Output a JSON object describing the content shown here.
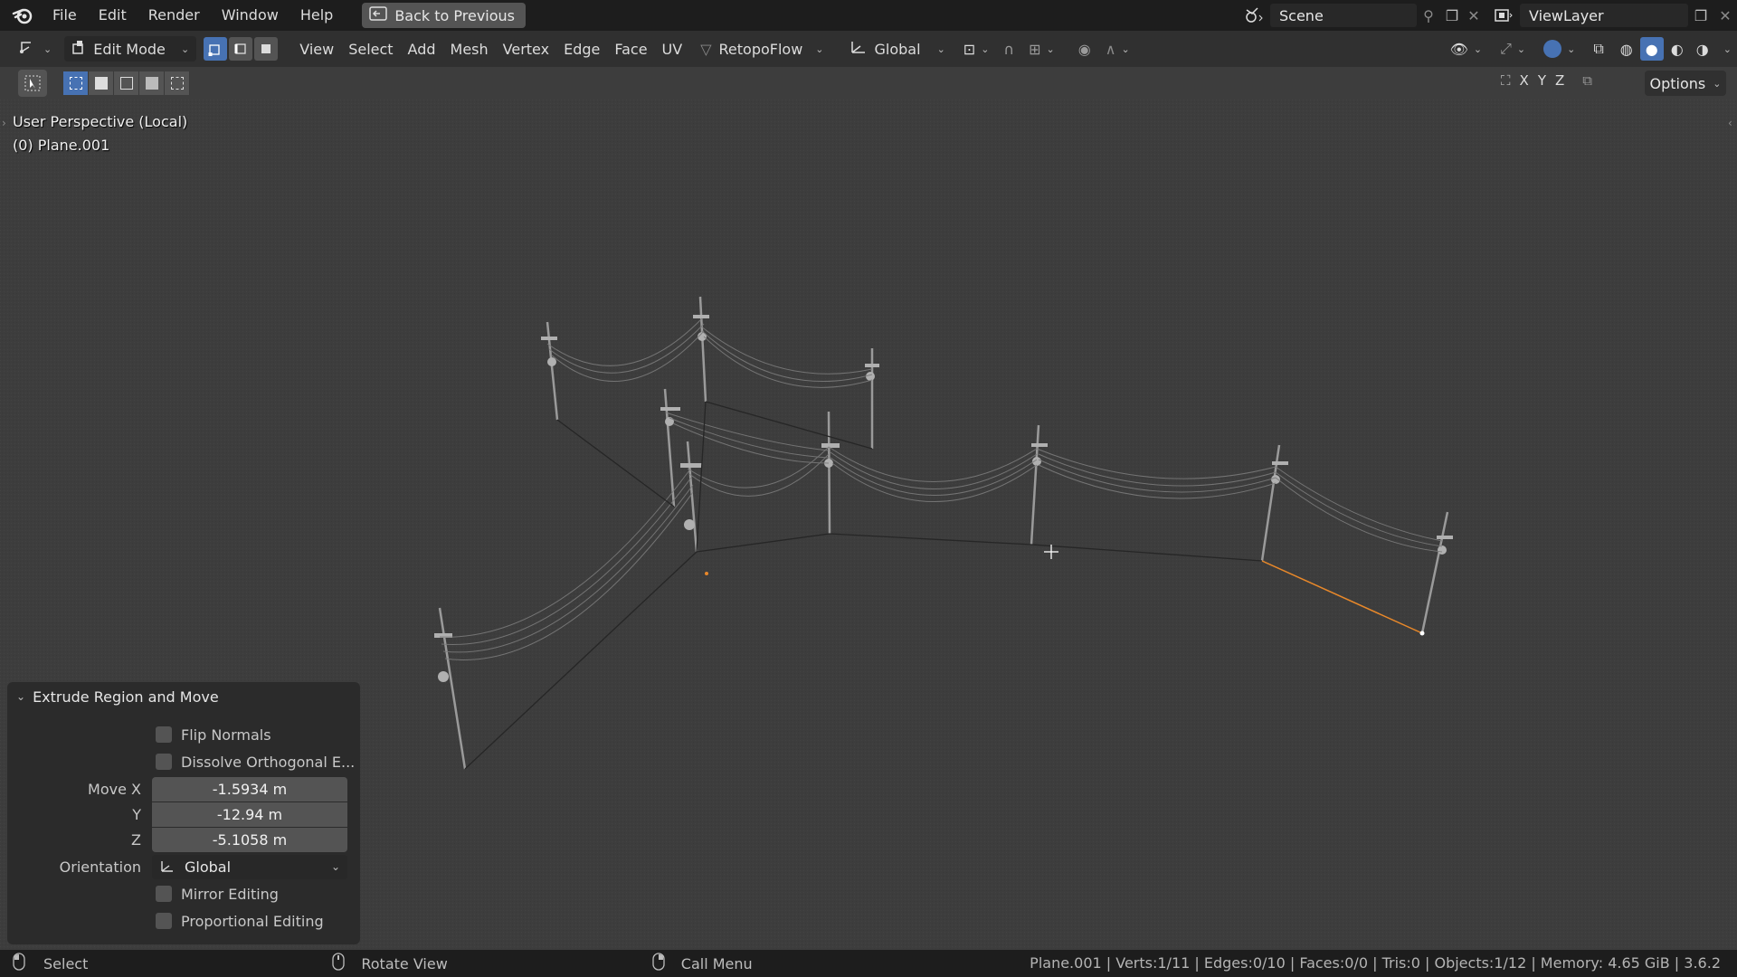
{
  "menus": [
    "File",
    "Edit",
    "Render",
    "Window",
    "Help"
  ],
  "back_button": "Back to Previous",
  "scene": "Scene",
  "view_layer": "ViewLayer",
  "header": {
    "mode": "Edit Mode",
    "menus": [
      "View",
      "Select",
      "Add",
      "Mesh",
      "Vertex",
      "Edge",
      "Face",
      "UV"
    ],
    "addon": "RetopoFlow",
    "orientation": "Global"
  },
  "toolrow": {
    "axes": [
      "X",
      "Y",
      "Z"
    ],
    "options": "Options"
  },
  "viewport": {
    "view_name": "User Perspective (Local)",
    "object": "(0) Plane.001"
  },
  "operator": {
    "title": "Extrude Region and Move",
    "flip_normals": "Flip Normals",
    "dissolve": "Dissolve Orthogonal E...",
    "move_label": "Move X",
    "y_label": "Y",
    "z_label": "Z",
    "move_x": "-1.5934 m",
    "move_y": "-12.94 m",
    "move_z": "-5.1058 m",
    "orientation_label": "Orientation",
    "orientation_value": "Global",
    "mirror": "Mirror Editing",
    "proportional": "Proportional Editing"
  },
  "status": {
    "select": "Select",
    "rotate": "Rotate View",
    "call_menu": "Call Menu",
    "stats": "Plane.001 | Verts:1/11 | Edges:0/10 | Faces:0/0 | Tris:0 | Objects:1/12 | Memory: 4.65 GiB | 3.6.2"
  },
  "colors": {
    "accent": "#4772b3",
    "selected_edge": "#e8882a"
  }
}
